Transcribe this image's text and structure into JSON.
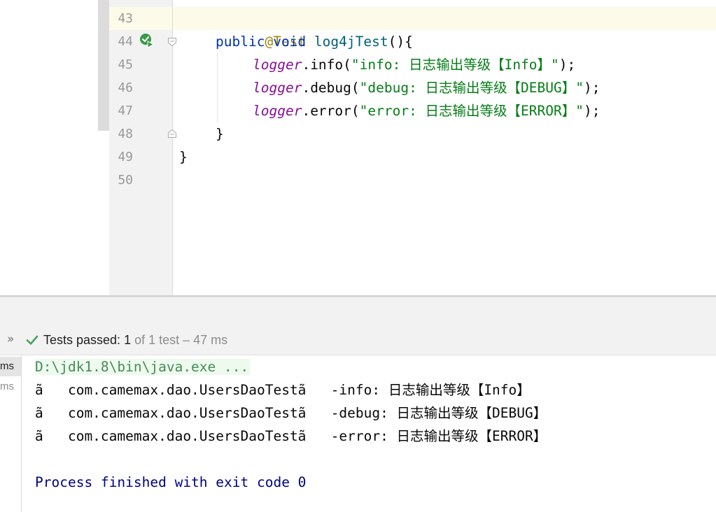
{
  "editor": {
    "line_numbers": [
      "43",
      "44",
      "45",
      "46",
      "47",
      "48",
      "49",
      "50"
    ],
    "code": {
      "l43_annotation": "@Test",
      "l44_kw1": "public",
      "l44_kw2": "void",
      "l44_method": "log4jTest",
      "l44_rest": "(){",
      "l45_field": "logger",
      "l45_call": ".info(",
      "l45_str": "\"info: 日志输出等级【Info】\"",
      "l45_end": ");",
      "l46_field": "logger",
      "l46_call": ".debug(",
      "l46_str": "\"debug: 日志输出等级【DEBUG】\"",
      "l46_end": ");",
      "l47_field": "logger",
      "l47_call": ".error(",
      "l47_str": "\"error: 日志输出等级【ERROR】\"",
      "l47_end": ");",
      "l48": "}",
      "l49": "}"
    },
    "colors": {
      "keyword": "#0033b3",
      "annotation": "#9e880d",
      "method": "#00627a",
      "field": "#871094",
      "string": "#067d17"
    },
    "icons": [
      "run-test-icon",
      "fold-start-icon",
      "fold-end-icon"
    ]
  },
  "run_panel": {
    "status": {
      "prefix": "Tests passed: ",
      "passed": "1",
      "suffix": " of 1 test – 47 ms"
    },
    "tree_items": [
      "ms",
      "ms"
    ],
    "console": {
      "command": "D:\\jdk1.8\\bin\\java.exe ...",
      "lines": [
        "ã   com.camemax.dao.UsersDaoTestã   -info: 日志输出等级【Info】",
        "ã   com.camemax.dao.UsersDaoTestã   -debug: 日志输出等级【DEBUG】",
        "ã   com.camemax.dao.UsersDaoTestã   -error: 日志输出等级【ERROR】"
      ],
      "exit_message": "Process finished with exit code 0"
    },
    "icons": [
      "expand-icon",
      "check-icon"
    ]
  }
}
